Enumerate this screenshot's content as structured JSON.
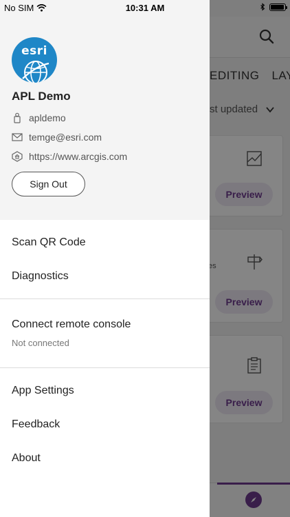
{
  "status_bar": {
    "carrier": "No SIM",
    "time": "10:31 AM",
    "battery_level": 0.95
  },
  "drawer": {
    "logo_text": "esri",
    "user": {
      "name": "APL Demo",
      "username": "apldemo",
      "email": "temge@esri.com",
      "portal_url": "https://www.arcgis.com"
    },
    "sign_out_label": "Sign Out",
    "menu": {
      "scan_qr": "Scan QR Code",
      "diagnostics": "Diagnostics",
      "connect_console": "Connect remote console",
      "console_status": "Not connected",
      "app_settings": "App Settings",
      "feedback": "Feedback",
      "about": "About"
    }
  },
  "background_app": {
    "tabs": [
      "EDITING",
      "LAY"
    ],
    "sort_label": "st updated",
    "preview_labels": [
      "Preview",
      "Preview",
      "Preview"
    ],
    "card_snippet": "es"
  },
  "colors": {
    "accent": "#6d3a8e",
    "esri_blue": "#1f87c7",
    "profile_bg": "#f4f4f4"
  },
  "icons": {
    "username": "user-icon",
    "email": "envelope-icon",
    "portal": "portal-home-icon"
  }
}
